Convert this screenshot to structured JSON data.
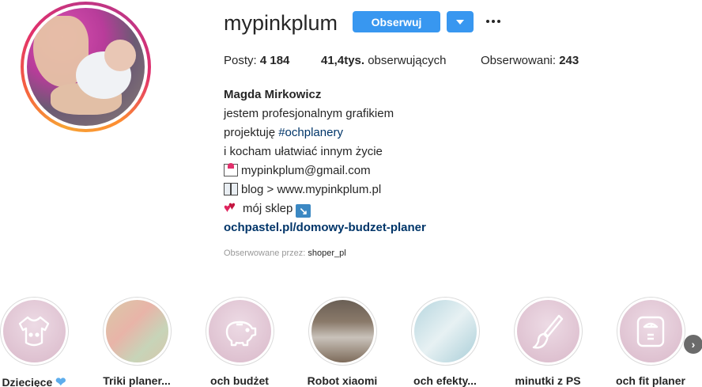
{
  "profile": {
    "username": "mypinkplum",
    "follow_label": "Obserwuj"
  },
  "stats": {
    "posts_label": "Posty: ",
    "posts_value": "4 184",
    "followers_value": "41,4tys.",
    "followers_label": " obserwujących",
    "following_label": "Obserwowani: ",
    "following_value": "243"
  },
  "bio": {
    "full_name": "Magda Mirkowicz",
    "line1": "jestem profesjonalnym grafikiem",
    "line2_prefix": "projektuję ",
    "line2_hashtag": "#ochplanery",
    "line3": "i kocham ułatwiać innym życie",
    "email": "mypinkplum@gmail.com",
    "blog": "blog > www.mypinkplum.pl",
    "shop": "mój sklep",
    "shop_arrow": "↘",
    "link": "ochpastel.pl/domowy-budzet-planer"
  },
  "followed_by": {
    "label": "Obserwowane przez: ",
    "user": "shoper_pl"
  },
  "highlights": [
    {
      "label": "Dziecięce",
      "icon": "baby-onesie-icon"
    },
    {
      "label": "Triki planer...",
      "icon": "photo"
    },
    {
      "label": "och budżet",
      "icon": "piggy-bank-icon"
    },
    {
      "label": "Robot xiaomi",
      "icon": "photo"
    },
    {
      "label": "och efekty...",
      "icon": "photo"
    },
    {
      "label": "minutki z PS",
      "icon": "brush-icon"
    },
    {
      "label": "och fit planer",
      "icon": "scale-icon"
    }
  ],
  "colors": {
    "accent": "#3897f0",
    "link": "#003569",
    "highlight_bg": "#e6cfdb"
  }
}
